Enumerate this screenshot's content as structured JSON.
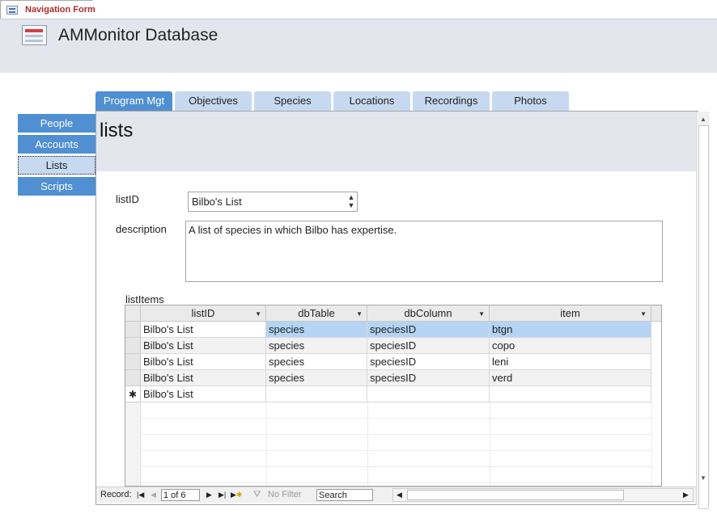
{
  "document_tab": {
    "label": "Navigation Form",
    "icon": "form-icon"
  },
  "header": {
    "title": "AMMonitor Database",
    "icon": "form-icon"
  },
  "left_nav": {
    "items": [
      {
        "label": "People",
        "selected": false
      },
      {
        "label": "Accounts",
        "selected": false
      },
      {
        "label": "Lists",
        "selected": true
      },
      {
        "label": "Scripts",
        "selected": false
      }
    ]
  },
  "top_tabs": [
    {
      "label": "Program Mgt",
      "selected": true
    },
    {
      "label": "Objectives",
      "selected": false
    },
    {
      "label": "Species",
      "selected": false
    },
    {
      "label": "Locations",
      "selected": false
    },
    {
      "label": "Recordings",
      "selected": false
    },
    {
      "label": "Photos",
      "selected": false
    }
  ],
  "subform": {
    "title": "lists",
    "listid_label": "listID",
    "listid_value": "Bilbo's List",
    "description_label": "description",
    "description_value": "A list of species in which Bilbo has expertise.",
    "listitems_label": "listItems"
  },
  "datasheet": {
    "columns": [
      "listID",
      "dbTable",
      "dbColumn",
      "item"
    ],
    "rows": [
      [
        "Bilbo's List",
        "species",
        "speciesID",
        "btgn"
      ],
      [
        "Bilbo's List",
        "species",
        "speciesID",
        "copo"
      ],
      [
        "Bilbo's List",
        "species",
        "speciesID",
        "leni"
      ],
      [
        "Bilbo's List",
        "species",
        "speciesID",
        "verd"
      ]
    ],
    "new_row": {
      "marker": "✱",
      "value": "Bilbo's List"
    },
    "selected_row_index": 0
  },
  "record_nav": {
    "record_label": "Record:",
    "current": "1 of 6",
    "filter_label": "No Filter",
    "search_label": "Search"
  },
  "colors": {
    "accent": "#4f8fd2",
    "tab_inactive": "#c6d9f0",
    "selected_cell": "#b5d4f4",
    "header_bg": "#e3e6ec"
  }
}
